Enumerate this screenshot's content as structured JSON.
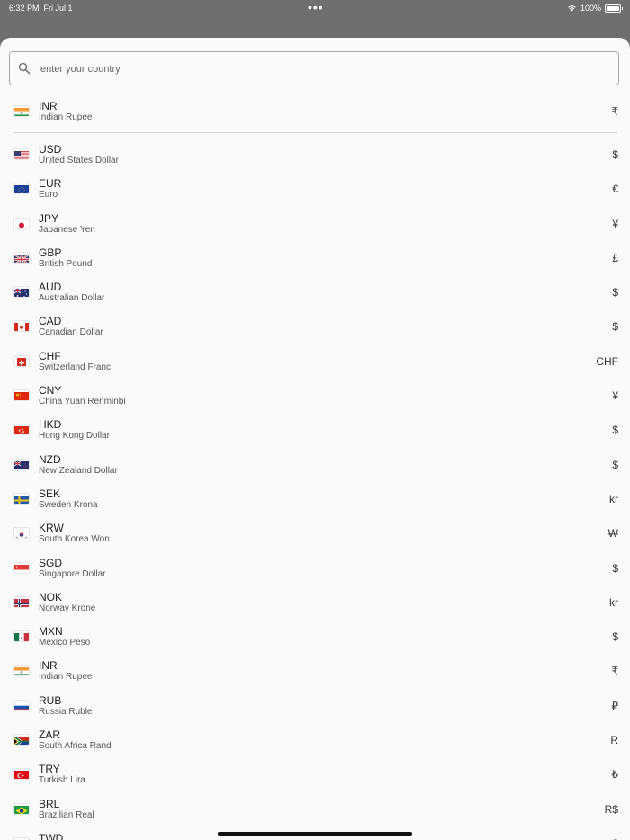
{
  "status_bar": {
    "time": "6:32 PM",
    "date": "Fri Jul 1",
    "dots": "•••",
    "battery": "100%"
  },
  "search": {
    "placeholder": "enter your country",
    "value": ""
  },
  "pinned": {
    "code": "INR",
    "name": "Indian Rupee",
    "symbol": "₹",
    "flag": "india-flag-icon"
  },
  "currencies": [
    {
      "code": "USD",
      "name": "United States Dollar",
      "symbol": "$",
      "flag": "usa-flag-icon"
    },
    {
      "code": "EUR",
      "name": "Euro",
      "symbol": "€",
      "flag": "eu-flag-icon"
    },
    {
      "code": "JPY",
      "name": "Japanese Yen",
      "symbol": "¥",
      "flag": "japan-flag-icon"
    },
    {
      "code": "GBP",
      "name": "British Pound",
      "symbol": "£",
      "flag": "uk-flag-icon"
    },
    {
      "code": "AUD",
      "name": "Australian Dollar",
      "symbol": "$",
      "flag": "australia-flag-icon"
    },
    {
      "code": "CAD",
      "name": "Canadian Dollar",
      "symbol": "$",
      "flag": "canada-flag-icon"
    },
    {
      "code": "CHF",
      "name": "Switzerland Franc",
      "symbol": "CHF",
      "flag": "switzerland-flag-icon"
    },
    {
      "code": "CNY",
      "name": "China Yuan Renminbi",
      "symbol": "¥",
      "flag": "china-flag-icon"
    },
    {
      "code": "HKD",
      "name": "Hong Kong Dollar",
      "symbol": "$",
      "flag": "hong-kong-flag-icon"
    },
    {
      "code": "NZD",
      "name": "New Zealand Dollar",
      "symbol": "$",
      "flag": "new-zealand-flag-icon"
    },
    {
      "code": "SEK",
      "name": "Sweden Krona",
      "symbol": "kr",
      "flag": "sweden-flag-icon"
    },
    {
      "code": "KRW",
      "name": "South Korea Won",
      "symbol": "₩",
      "flag": "south-korea-flag-icon"
    },
    {
      "code": "SGD",
      "name": "Singapore Dollar",
      "symbol": "$",
      "flag": "singapore-flag-icon"
    },
    {
      "code": "NOK",
      "name": "Norway Krone",
      "symbol": "kr",
      "flag": "norway-flag-icon"
    },
    {
      "code": "MXN",
      "name": "Mexico Peso",
      "symbol": "$",
      "flag": "mexico-flag-icon"
    },
    {
      "code": "INR",
      "name": "Indian Rupee",
      "symbol": "₹",
      "flag": "india-flag-icon"
    },
    {
      "code": "RUB",
      "name": "Russia Ruble",
      "symbol": "₽",
      "flag": "russia-flag-icon"
    },
    {
      "code": "ZAR",
      "name": "South Africa Rand",
      "symbol": "R",
      "flag": "south-africa-flag-icon"
    },
    {
      "code": "TRY",
      "name": "Turkish Lira",
      "symbol": "₺",
      "flag": "turkey-flag-icon"
    },
    {
      "code": "BRL",
      "name": "Brazilian Real",
      "symbol": "R$",
      "flag": "brazil-flag-icon"
    },
    {
      "code": "TWD",
      "name": "",
      "symbol": "$",
      "flag": "taiwan-flag-icon"
    }
  ]
}
